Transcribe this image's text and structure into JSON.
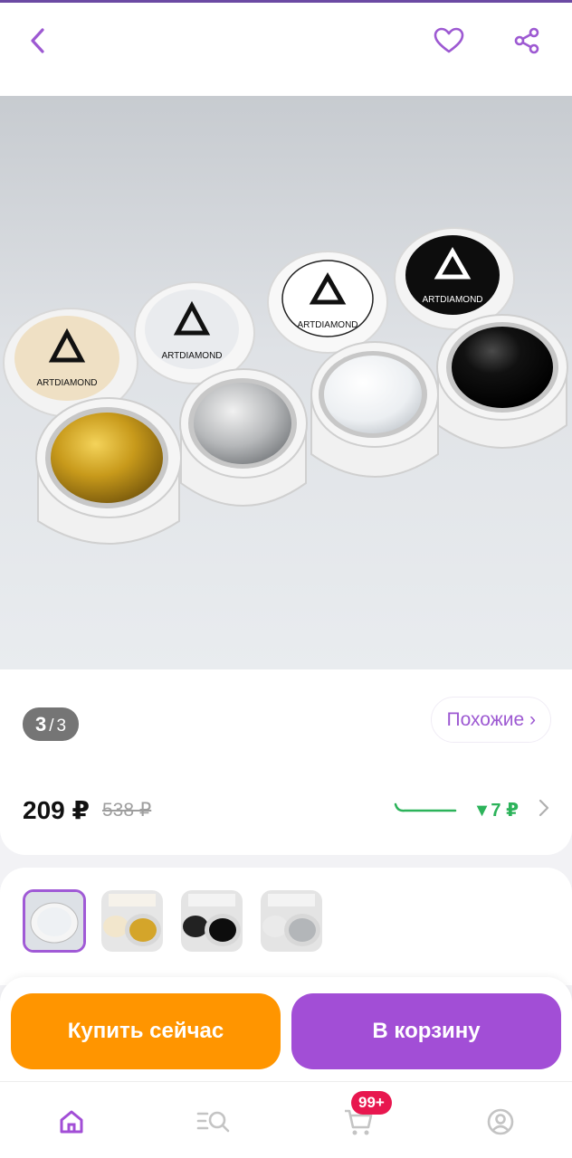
{
  "header": {
    "back_icon": "chevron-left-icon",
    "favorite_icon": "heart-icon",
    "share_icon": "share-icon"
  },
  "gallery": {
    "current": "3",
    "separator": "/",
    "total": "3"
  },
  "similar_label": "Похожие ›",
  "price": {
    "current": "209 ₽",
    "old": "538 ₽",
    "drop": "▼7 ₽"
  },
  "product_jars": [
    {
      "brand": "ARTDIAMOND",
      "color": "gold"
    },
    {
      "brand": "ARTDIAMOND",
      "color": "silver"
    },
    {
      "brand": "ARTDIAMOND",
      "color": "white"
    },
    {
      "brand": "ARTDIAMOND",
      "color": "black"
    }
  ],
  "thumbnails": [
    {
      "selected": true,
      "variant": "white"
    },
    {
      "selected": false,
      "variant": "gold"
    },
    {
      "selected": false,
      "variant": "black"
    },
    {
      "selected": false,
      "variant": "silver"
    }
  ],
  "actions": {
    "buy_now": "Купить сейчас",
    "add_to_cart": "В корзину"
  },
  "bottom_nav": {
    "cart_badge": "99+"
  },
  "colors": {
    "accent": "#a24ed6",
    "buy": "#ff9500",
    "drop": "#2cb35a",
    "badge": "#e8174f"
  }
}
